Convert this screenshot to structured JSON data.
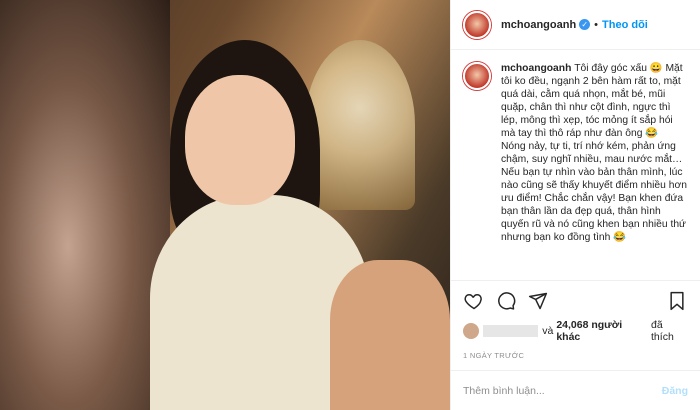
{
  "header": {
    "username": "mchoangoanh",
    "follow_label": "Theo dõi",
    "separator": "•"
  },
  "caption": {
    "username": "mchoangoanh",
    "text": "Tôi đây góc xấu 😀 Mặt tôi ko đều, ngạnh 2 bên hàm rất to, mặt quá dài, cằm quá nhọn, mắt bé, mũi quặp, chân thì như cột đình, ngực thì lép, mông thì xẹp, tóc mỏng ít sắp hói mà tay thì thô ráp như đàn ông 😂",
    "text2": "Nóng nảy, tự ti, trí nhớ kém, phản ứng chậm, suy nghĩ nhiều, mau nước mắt… Nếu bạn tự nhìn vào bản thân mình, lúc nào cũng sẽ thấy khuyết điểm nhiều hơn ưu điểm! Chắc chắn vậy! Bạn khen đứa bạn thân lần da đẹp quá, thân hình quyến rũ và nó cũng khen bạn nhiều thứ nhưng bạn ko đồng tình 😂"
  },
  "likes": {
    "and_label": "và",
    "count": "24,068 người khác",
    "liked_label": "đã thích"
  },
  "time": "1 NGÀY TRƯỚC",
  "comment": {
    "placeholder": "Thêm bình luận...",
    "post_label": "Đăng"
  },
  "icons": {
    "like": "heart-icon",
    "comment": "comment-icon",
    "share": "share-icon",
    "save": "bookmark-icon"
  },
  "colors": {
    "accent": "#0095f6",
    "verified": "#3897f0",
    "muted": "#8e8e8e",
    "post_disabled": "#b2dffc"
  }
}
